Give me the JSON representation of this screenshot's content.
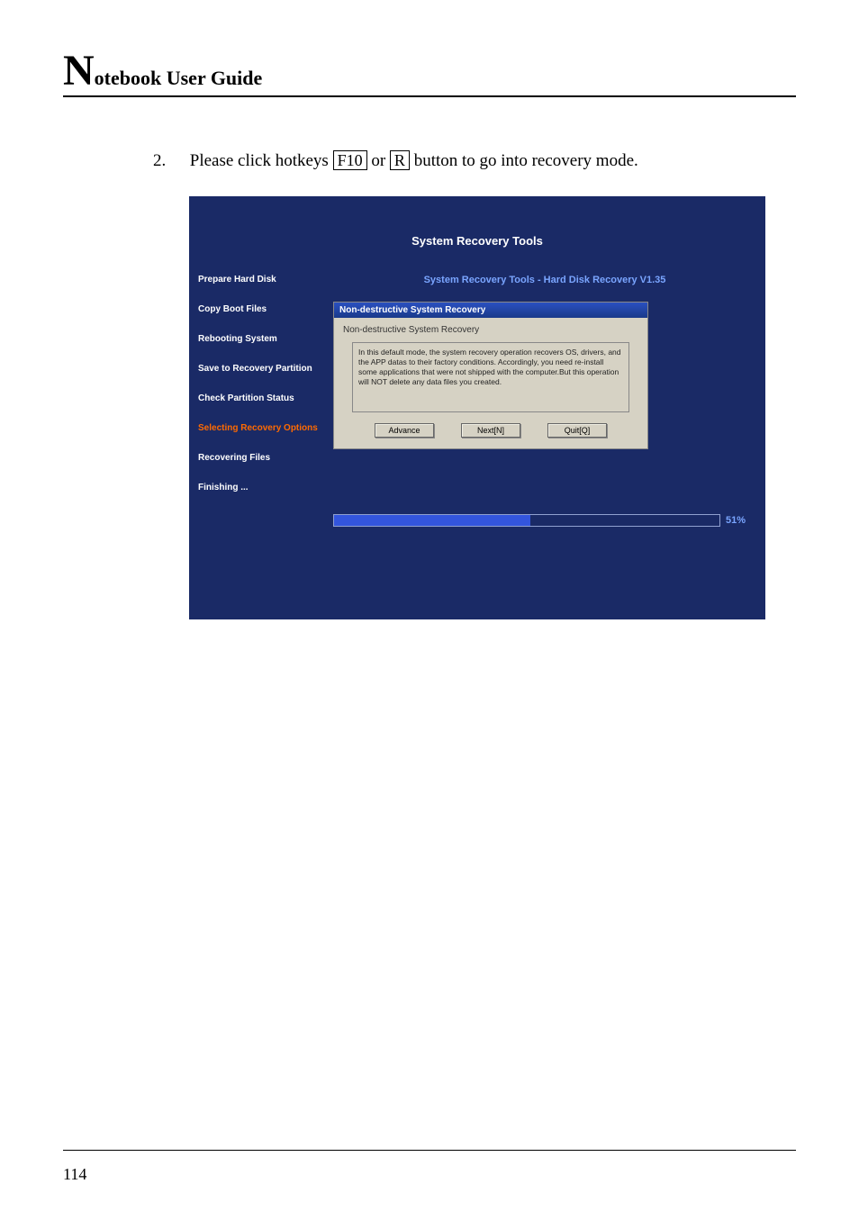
{
  "header": {
    "big_initial": "N",
    "rest": "otebook User Guide"
  },
  "instruction": {
    "number": "2.",
    "prefix": "Please click hotkeys ",
    "key1": "F10",
    "mid": " or ",
    "key2": "R",
    "suffix": " button to go into recovery mode."
  },
  "screenshot": {
    "title": "System Recovery Tools",
    "right_title": "System Recovery Tools - Hard Disk Recovery V1.35",
    "steps": [
      "Prepare Hard Disk",
      "Copy Boot Files",
      "Rebooting System",
      "Save to Recovery Partition",
      "Check Partition Status",
      "Selecting Recovery Options",
      "Recovering Files",
      "Finishing ..."
    ],
    "active_step_index": 5,
    "dialog": {
      "header": "Non-destructive System Recovery",
      "sub": "Non-destructive System Recovery",
      "body": "In this default mode,  the system recovery operation recovers OS, drivers, and the APP datas to their factory conditions. Accordingly, you need re-install some applications that were not shipped with the computer.But this operation will NOT delete any data files you created.",
      "buttons": {
        "advance": "Advance",
        "next": "Next[N]",
        "quit": "Quit[Q]"
      }
    },
    "progress": {
      "percent_label": "51%",
      "fill_width": "51%"
    }
  },
  "footer": {
    "page_number": "114"
  }
}
